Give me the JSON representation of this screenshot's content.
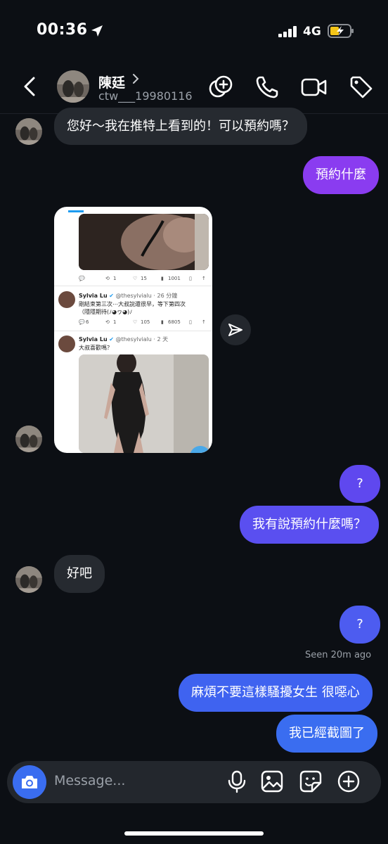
{
  "status_bar": {
    "time": "00:36",
    "network": "4G"
  },
  "header": {
    "name": "陳廷",
    "username": "ctw___19980116"
  },
  "messages": {
    "m1": "您好～我在推特上看到的！可以預約嗎？",
    "m2": "預約什麼",
    "m3": "?",
    "m4": "我有說預約什麼嗎？",
    "m5": "好吧",
    "m6": "?",
    "m7": "麻煩不要這樣騷擾女生 很噁心",
    "m8": "我已經截圖了"
  },
  "seen": "Seen 20m ago",
  "shared_post": {
    "tweet1": {
      "replies": "",
      "retweets": "1",
      "likes": "15",
      "views": "1001"
    },
    "tweet2": {
      "author": "Sylvia Lu",
      "handle": "@thesylvialu · 26 分鐘",
      "text_line1": "剛結束第三次⋯大叔說還很早，等下第四次",
      "text_line2": "（隱隱期待(ﾉ◕ヮ◕)ﾉ",
      "replies": "6",
      "retweets": "1",
      "likes": "105",
      "views": "6805"
    },
    "tweet3": {
      "author": "Sylvia Lu",
      "handle": "@thesylvialu · 2 天",
      "text": "大叔喜歡嗎？"
    }
  },
  "composer": {
    "placeholder": "Message..."
  },
  "colors": {
    "background": "#0c0f14",
    "received_bubble": "#262a30",
    "sent_purple": "#8a3cf0",
    "sent_violet": "#5a4ff0",
    "sent_blue": "#3a6df0",
    "accent_camera": "#3a6df0"
  },
  "icons": [
    "location-arrow-icon",
    "signal-icon",
    "battery-charging-icon",
    "back-chevron-icon",
    "chevron-right-icon",
    "effects-icon",
    "phone-icon",
    "video-icon",
    "tag-icon",
    "send-icon",
    "camera-icon",
    "microphone-icon",
    "gallery-icon",
    "sticker-icon",
    "add-icon"
  ]
}
